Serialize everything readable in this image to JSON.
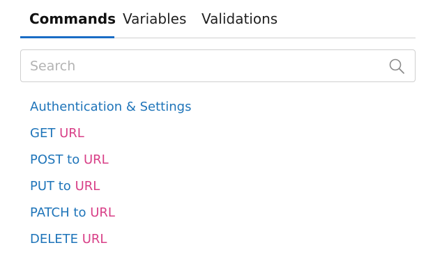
{
  "tabs": [
    {
      "label": "Commands",
      "active": true
    },
    {
      "label": "Variables",
      "active": false
    },
    {
      "label": "Validations",
      "active": false
    }
  ],
  "search": {
    "placeholder": "Search",
    "value": ""
  },
  "commands": [
    {
      "text": "Authentication & Settings",
      "param": ""
    },
    {
      "text": "GET",
      "param": "URL"
    },
    {
      "text": "POST to",
      "param": "URL"
    },
    {
      "text": "PUT to",
      "param": "URL"
    },
    {
      "text": "PATCH to",
      "param": "URL"
    },
    {
      "text": "DELETE",
      "param": "URL"
    }
  ],
  "colors": {
    "accent": "#1a6dc5",
    "command_text": "#1e74b9",
    "param_text": "#d83f87",
    "border": "#cfcfcf"
  },
  "icons": {
    "search": "search-icon"
  }
}
